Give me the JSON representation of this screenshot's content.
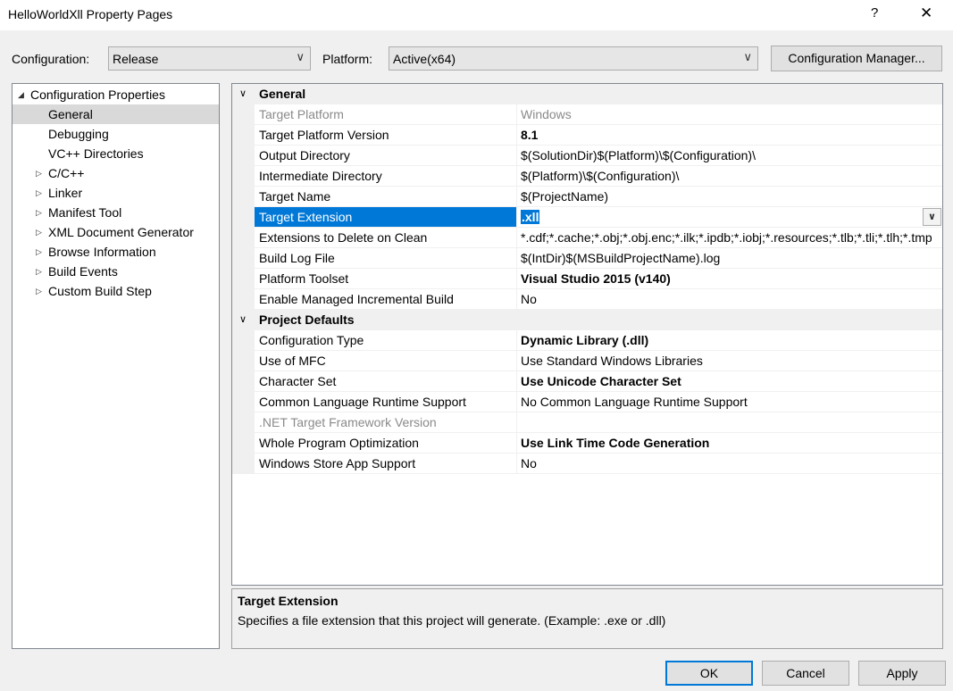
{
  "window": {
    "title": "HelloWorldXll Property Pages",
    "help_glyph": "?",
    "close_glyph": "✕"
  },
  "toolbar": {
    "configuration_label": "Configuration:",
    "configuration_value": "Release",
    "platform_label": "Platform:",
    "platform_value": "Active(x64)",
    "config_manager_label": "Configuration Manager..."
  },
  "tree": {
    "root": "Configuration Properties",
    "items": [
      {
        "label": "General",
        "expandable": false,
        "selected": true
      },
      {
        "label": "Debugging",
        "expandable": false
      },
      {
        "label": "VC++ Directories",
        "expandable": false
      },
      {
        "label": "C/C++",
        "expandable": true
      },
      {
        "label": "Linker",
        "expandable": true
      },
      {
        "label": "Manifest Tool",
        "expandable": true
      },
      {
        "label": "XML Document Generator",
        "expandable": true
      },
      {
        "label": "Browse Information",
        "expandable": true
      },
      {
        "label": "Build Events",
        "expandable": true
      },
      {
        "label": "Custom Build Step",
        "expandable": true
      }
    ]
  },
  "grid": {
    "categories": [
      {
        "name": "General",
        "properties": [
          {
            "name": "Target Platform",
            "value": "Windows",
            "disabled": true
          },
          {
            "name": "Target Platform Version",
            "value": "8.1",
            "bold": true
          },
          {
            "name": "Output Directory",
            "value": "$(SolutionDir)$(Platform)\\$(Configuration)\\"
          },
          {
            "name": "Intermediate Directory",
            "value": "$(Platform)\\$(Configuration)\\"
          },
          {
            "name": "Target Name",
            "value": "$(ProjectName)"
          },
          {
            "name": "Target Extension",
            "value": ".xll",
            "bold": true,
            "selected": true
          },
          {
            "name": "Extensions to Delete on Clean",
            "value": "*.cdf;*.cache;*.obj;*.obj.enc;*.ilk;*.ipdb;*.iobj;*.resources;*.tlb;*.tli;*.tlh;*.tmp"
          },
          {
            "name": "Build Log File",
            "value": "$(IntDir)$(MSBuildProjectName).log"
          },
          {
            "name": "Platform Toolset",
            "value": "Visual Studio 2015 (v140)",
            "bold": true
          },
          {
            "name": "Enable Managed Incremental Build",
            "value": "No"
          }
        ]
      },
      {
        "name": "Project Defaults",
        "properties": [
          {
            "name": "Configuration Type",
            "value": "Dynamic Library (.dll)",
            "bold": true
          },
          {
            "name": "Use of MFC",
            "value": "Use Standard Windows Libraries"
          },
          {
            "name": "Character Set",
            "value": "Use Unicode Character Set",
            "bold": true
          },
          {
            "name": "Common Language Runtime Support",
            "value": "No Common Language Runtime Support"
          },
          {
            "name": ".NET Target Framework Version",
            "value": "",
            "disabled": true
          },
          {
            "name": "Whole Program Optimization",
            "value": "Use Link Time Code Generation",
            "bold": true
          },
          {
            "name": "Windows Store App Support",
            "value": "No"
          }
        ]
      }
    ]
  },
  "description": {
    "title": "Target Extension",
    "text": "Specifies a file extension that this project will generate. (Example: .exe or .dll)"
  },
  "buttons": {
    "ok": "OK",
    "cancel": "Cancel",
    "apply": "Apply"
  },
  "icons": {
    "expanded": "◢",
    "collapsed": "▷",
    "category_expanded": "∨",
    "dropdown": "∨"
  }
}
